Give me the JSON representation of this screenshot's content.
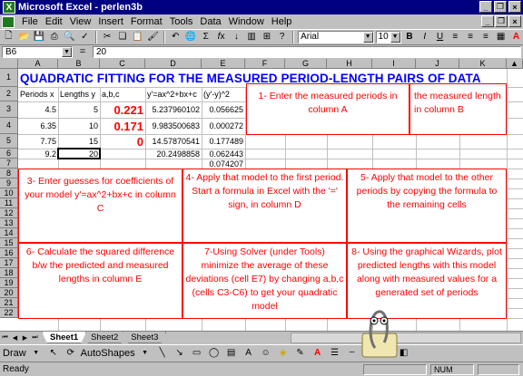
{
  "window": {
    "title": "Microsoft Excel - perlen3b",
    "app_icon": "excel-icon"
  },
  "menu": {
    "items": [
      "File",
      "Edit",
      "View",
      "Insert",
      "Format",
      "Tools",
      "Data",
      "Window",
      "Help"
    ]
  },
  "toolbar": {
    "font_name": "Arial",
    "font_size": "10",
    "icons": [
      "new-icon",
      "open-icon",
      "save-icon",
      "print-icon",
      "print-preview-icon",
      "spelling-icon",
      "cut-icon",
      "copy-icon",
      "paste-icon",
      "format-painter-icon",
      "undo-icon",
      "hyperlink-icon",
      "autosum-icon",
      "function-icon",
      "sort-asc-icon",
      "chart-wizard-icon",
      "zoom-icon",
      "help-icon"
    ],
    "bold": "B",
    "italic": "I",
    "underline": "U"
  },
  "formula_bar": {
    "name_box": "B6",
    "equals": "=",
    "content": "20"
  },
  "grid": {
    "columns": [
      "A",
      "B",
      "C",
      "D",
      "E",
      "F",
      "G",
      "H",
      "I",
      "J",
      "K"
    ],
    "rows": [
      "1",
      "2",
      "3",
      "4",
      "5",
      "6",
      "7",
      "8",
      "9",
      "10",
      "11",
      "12",
      "13",
      "14",
      "15",
      "16",
      "17",
      "18",
      "19",
      "20",
      "21",
      "22"
    ],
    "title": "QUADRATIC FITTING FOR THE MEASURED PERIOD-LENGTH PAIRS OF DATA",
    "headers": {
      "a": "Periods x",
      "b": "Lengths y",
      "c": "a,b,c",
      "d": "y'=ax^2+bx+c",
      "e": "(y'-y)^2"
    },
    "data": [
      {
        "a": "4.5",
        "b": "5",
        "c": "0.221",
        "d": "5.237960102",
        "e": "0.056625"
      },
      {
        "a": "6.35",
        "b": "10",
        "c": "0.171",
        "d": "9.983500683",
        "e": "0.000272"
      },
      {
        "a": "7.75",
        "b": "15",
        "c": "0",
        "d": "14.57870541",
        "e": "0.177489"
      },
      {
        "a": "9.2",
        "b": "20",
        "c": "",
        "d": "20.2498858",
        "e": "0.062443"
      }
    ],
    "e7": "0.074207"
  },
  "instructions": {
    "step1": "1- Enter the measured periods in column A",
    "step2": "the measured length in column B",
    "step3": "3- Enter guesses for coefficients of your model y'=ax^2+bx+c in column C",
    "step4": "4- Apply that model to the first period. Start a formula in Excel with the '=' sign, in column D",
    "step5": "5- Apply that model to the other periods by copying the formula to the remaining cells",
    "step6": "6- Calculate the squared difference b/w the predicted and measured lengths in column E",
    "step7": "7-Using Solver (under Tools) minimize the average of these deviations (cell E7) by changing a,b,c (cells C3-C6) to get your quadratic model",
    "step8": "8- Using the graphical Wizards, plot predicted lengths with this model along with measured values for a generated set of periods"
  },
  "sheets": {
    "tabs": [
      "Sheet1",
      "Sheet2",
      "Sheet3"
    ],
    "active": "Sheet1"
  },
  "drawing": {
    "draw_label": "Draw",
    "autoshapes_label": "AutoShapes"
  },
  "status": {
    "text": "Ready",
    "num": "NUM"
  },
  "colors": {
    "title_bar": "#000080",
    "instruction_red": "#ff0000",
    "heading_blue": "#0000ff"
  }
}
